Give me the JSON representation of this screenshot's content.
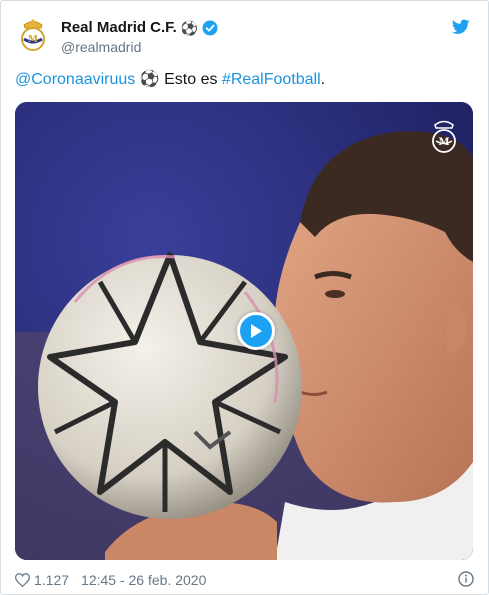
{
  "account": {
    "name": "Real Madrid C.F.",
    "handle": "@realmadrid",
    "name_emoji": "⚽"
  },
  "tweet": {
    "mention": "@Coronaaviruus",
    "emoji": "⚽",
    "text": " Esto es ",
    "hashtag": "#RealFootball",
    "trailing": "."
  },
  "footer": {
    "likes": "1.127",
    "timestamp": "12:45 - 26 feb. 2020"
  },
  "icons": {
    "avatar": "real-madrid-crest-icon",
    "verified": "verified-badge-icon",
    "platform": "twitter-bird-icon",
    "play": "play-icon",
    "like": "heart-icon",
    "info": "info-icon"
  },
  "colors": {
    "link": "#1b95e0",
    "verified": "#1da1f2",
    "play_button": "#1da1f2",
    "muted": "#657786"
  }
}
